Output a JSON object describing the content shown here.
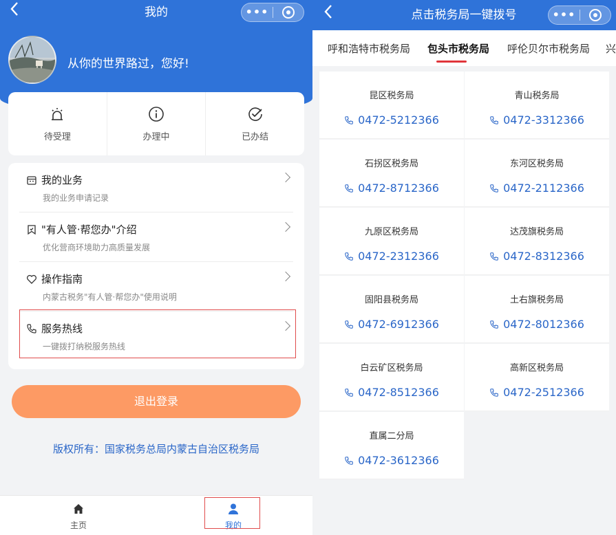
{
  "left": {
    "nav_title": "我的",
    "capsule_more": "•••",
    "greeting": "从你的世界路过，您好!",
    "status": [
      {
        "label": "待受理",
        "icon": "alarm-icon"
      },
      {
        "label": "办理中",
        "icon": "info-icon"
      },
      {
        "label": "已办结",
        "icon": "check-circle-icon"
      }
    ],
    "menu": [
      {
        "title": "我的业务",
        "sub": "我的业务申请记录",
        "icon": "business-icon"
      },
      {
        "title": "\"有人管·帮您办\"介绍",
        "sub": "优化营商环境助力高质量发展",
        "icon": "bookmark-icon"
      },
      {
        "title": "操作指南",
        "sub": "内蒙古税务\"有人管·帮您办\"使用说明",
        "icon": "heart-icon"
      },
      {
        "title": "服务热线",
        "sub": "一键拨打纳税服务热线",
        "icon": "phone-icon"
      }
    ],
    "logout": "退出登录",
    "copyright": "版权所有：国家税务总局内蒙古自治区税务局",
    "tabs": [
      {
        "label": "主页",
        "icon": "home-icon"
      },
      {
        "label": "我的",
        "icon": "user-icon"
      }
    ]
  },
  "right": {
    "nav_title": "点击税务局一键拨号",
    "capsule_more": "•••",
    "regions": [
      "呼和浩特市税务局",
      "包头市税务局",
      "呼伦贝尔市税务局",
      "兴"
    ],
    "active_region": 1,
    "offices": [
      {
        "name": "昆区税务局",
        "phone": "0472-5212366"
      },
      {
        "name": "青山税务局",
        "phone": "0472-3312366"
      },
      {
        "name": "石拐区税务局",
        "phone": "0472-8712366"
      },
      {
        "name": "东河区税务局",
        "phone": "0472-2112366"
      },
      {
        "name": "九原区税务局",
        "phone": "0472-2312366"
      },
      {
        "name": "达茂旗税务局",
        "phone": "0472-8312366"
      },
      {
        "name": "固阳县税务局",
        "phone": "0472-6912366"
      },
      {
        "name": "土右旗税务局",
        "phone": "0472-8012366"
      },
      {
        "name": "白云矿区税务局",
        "phone": "0472-8512366"
      },
      {
        "name": "高新区税务局",
        "phone": "0472-2512366"
      },
      {
        "name": "直属二分局",
        "phone": "0472-3612366"
      }
    ]
  },
  "colors": {
    "primary": "#2f73d9",
    "logout": "#fd9a64",
    "link": "#2a66c8",
    "highlight": "#e04b4b"
  }
}
